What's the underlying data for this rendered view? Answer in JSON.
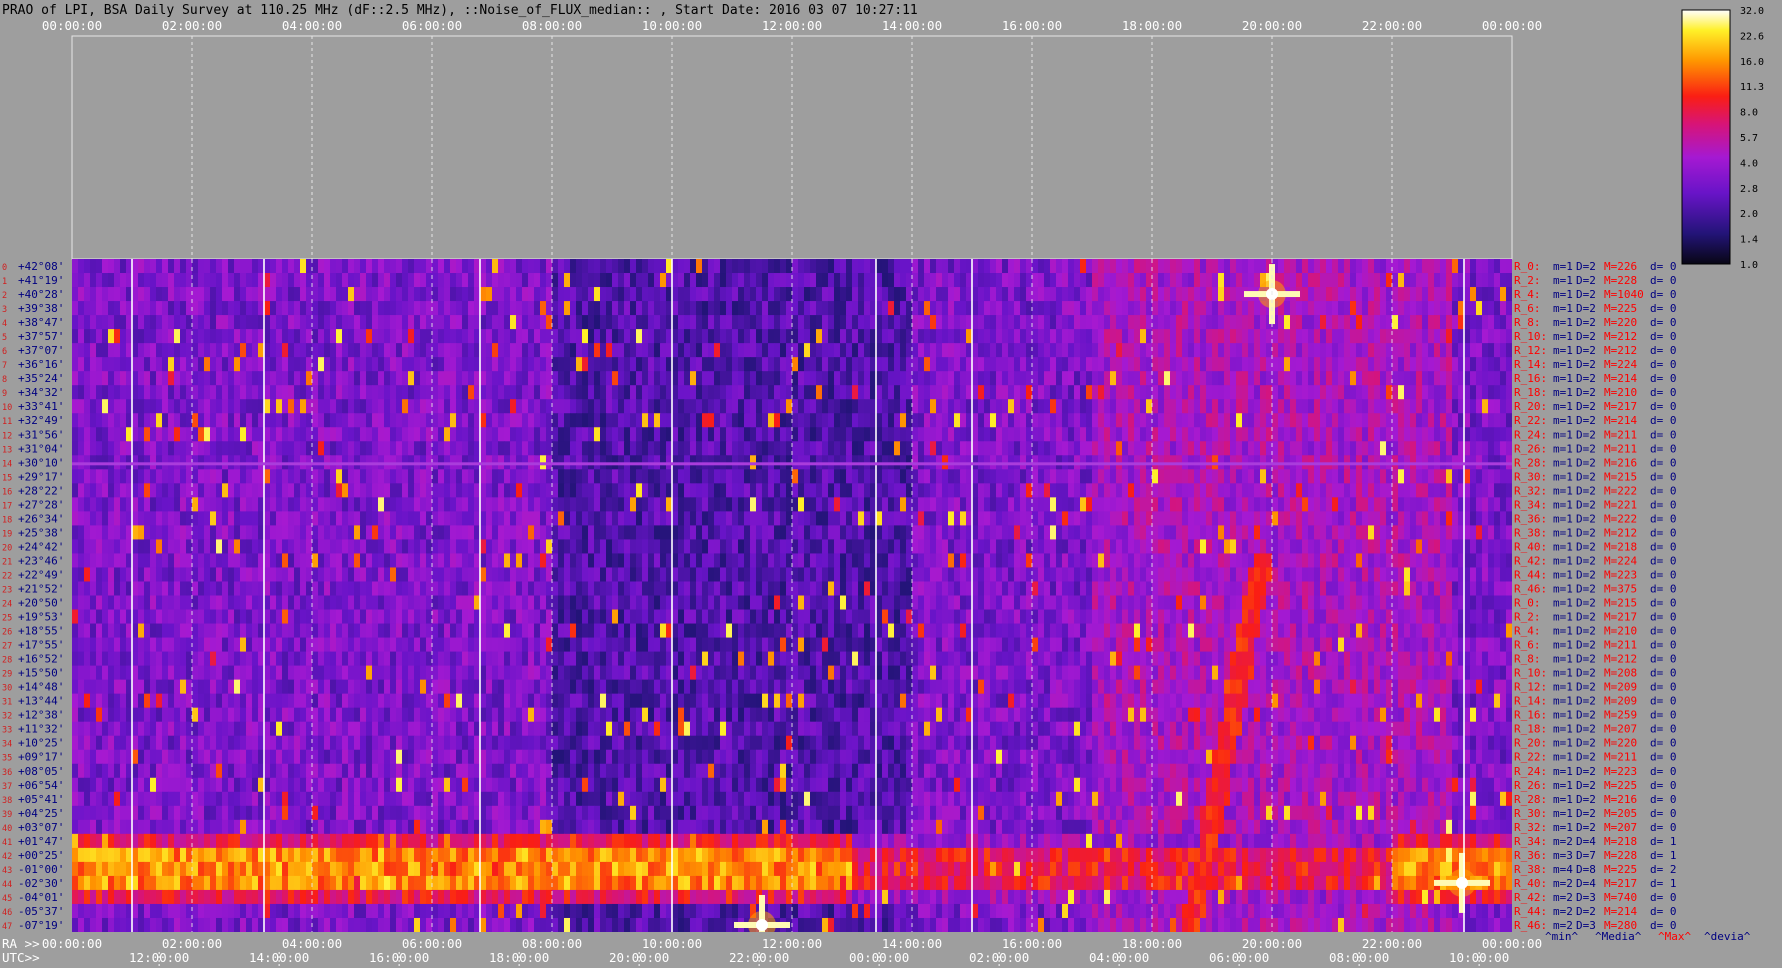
{
  "title": "PRAO of LPI, BSA Daily Survey at 110.25 MHz (dF::2.5 MHz), ::Noise_of_FLUX_median:: , Start Date: 2016 03 07 10:27:11",
  "colors": {
    "background": "#9e9e9e",
    "row_label": "#000080",
    "stat_red": "#ff0000",
    "stat_navy": "#000080"
  },
  "top_axis_labels": [
    "00:00:00",
    "02:00:00",
    "04:00:00",
    "06:00:00",
    "08:00:00",
    "10:00:00",
    "12:00:00",
    "14:00:00",
    "16:00:00",
    "18:00:00",
    "20:00:00",
    "22:00:00",
    "00:00:00"
  ],
  "ra_axis": {
    "prefix": "RA >>",
    "labels": [
      "00:00:00",
      "02:00:00",
      "04:00:00",
      "06:00:00",
      "08:00:00",
      "10:00:00",
      "12:00:00",
      "14:00:00",
      "16:00:00",
      "18:00:00",
      "20:00:00",
      "22:00:00",
      "00:00:00"
    ]
  },
  "utc_axis": {
    "prefix": "UTC>>",
    "labels": [
      "12:00:00",
      "14:00:00",
      "16:00:00",
      "18:00:00",
      "20:00:00",
      "22:00:00",
      "00:00:00",
      "02:00:00",
      "04:00:00",
      "06:00:00",
      "08:00:00",
      "10:00:00"
    ]
  },
  "colorbar": {
    "ticks": [
      "32.0",
      "22.6",
      "16.0",
      "11.3",
      "8.0",
      "5.7",
      "4.0",
      "2.8",
      "2.0",
      "1.4",
      "1.0"
    ]
  },
  "declinations": [
    "+42°08'",
    "+41°19'",
    "+40°28'",
    "+39°38'",
    "+38°47'",
    "+37°57'",
    "+37°07'",
    "+36°16'",
    "+35°24'",
    "+34°32'",
    "+33°41'",
    "+32°49'",
    "+31°56'",
    "+31°04'",
    "+30°10'",
    "+29°17'",
    "+28°22'",
    "+27°28'",
    "+26°34'",
    "+25°38'",
    "+24°42'",
    "+23°46'",
    "+22°49'",
    "+21°52'",
    "+20°50'",
    "+19°53'",
    "+18°55'",
    "+17°55'",
    "+16°52'",
    "+15°50'",
    "+14°48'",
    "+13°44'",
    "+12°38'",
    "+11°32'",
    "+10°25'",
    "+09°17'",
    "+08°05'",
    "+06°54'",
    "+05°41'",
    "+04°25'",
    "+03°07'",
    "+01°47'",
    "+00°25'",
    "-01°00'",
    "-02°30'",
    "-04°01'",
    "-05°37'",
    "-07°19'"
  ],
  "stats_rows": [
    {
      "r": "R_0:",
      "m": "m=1",
      "d": "D=2",
      "M": "M=226",
      "dv": "d= 0"
    },
    {
      "r": "R_2:",
      "m": "m=1",
      "d": "D=2",
      "M": "M=228",
      "dv": "d= 0"
    },
    {
      "r": "R_4:",
      "m": "m=1",
      "d": "D=2",
      "M": "M=1040",
      "dv": "d= 0"
    },
    {
      "r": "R_6:",
      "m": "m=1",
      "d": "D=2",
      "M": "M=225",
      "dv": "d= 0"
    },
    {
      "r": "R_8:",
      "m": "m=1",
      "d": "D=2",
      "M": "M=220",
      "dv": "d= 0"
    },
    {
      "r": "R_10:",
      "m": "m=1",
      "d": "D=2",
      "M": "M=212",
      "dv": "d= 0"
    },
    {
      "r": "R_12:",
      "m": "m=1",
      "d": "D=2",
      "M": "M=212",
      "dv": "d= 0"
    },
    {
      "r": "R_14:",
      "m": "m=1",
      "d": "D=2",
      "M": "M=224",
      "dv": "d= 0"
    },
    {
      "r": "R_16:",
      "m": "m=1",
      "d": "D=2",
      "M": "M=214",
      "dv": "d= 0"
    },
    {
      "r": "R_18:",
      "m": "m=1",
      "d": "D=2",
      "M": "M=210",
      "dv": "d= 0"
    },
    {
      "r": "R_20:",
      "m": "m=1",
      "d": "D=2",
      "M": "M=217",
      "dv": "d= 0"
    },
    {
      "r": "R_22:",
      "m": "m=1",
      "d": "D=2",
      "M": "M=214",
      "dv": "d= 0"
    },
    {
      "r": "R_24:",
      "m": "m=1",
      "d": "D=2",
      "M": "M=211",
      "dv": "d= 0"
    },
    {
      "r": "R_26:",
      "m": "m=1",
      "d": "D=2",
      "M": "M=211",
      "dv": "d= 0"
    },
    {
      "r": "R_28:",
      "m": "m=1",
      "d": "D=2",
      "M": "M=216",
      "dv": "d= 0"
    },
    {
      "r": "R_30:",
      "m": "m=1",
      "d": "D=2",
      "M": "M=215",
      "dv": "d= 0"
    },
    {
      "r": "R_32:",
      "m": "m=1",
      "d": "D=2",
      "M": "M=222",
      "dv": "d= 0"
    },
    {
      "r": "R_34:",
      "m": "m=1",
      "d": "D=2",
      "M": "M=221",
      "dv": "d= 0"
    },
    {
      "r": "R_36:",
      "m": "m=1",
      "d": "D=2",
      "M": "M=222",
      "dv": "d= 0"
    },
    {
      "r": "R_38:",
      "m": "m=1",
      "d": "D=2",
      "M": "M=212",
      "dv": "d= 0"
    },
    {
      "r": "R_40:",
      "m": "m=1",
      "d": "D=2",
      "M": "M=218",
      "dv": "d= 0"
    },
    {
      "r": "R_42:",
      "m": "m=1",
      "d": "D=2",
      "M": "M=224",
      "dv": "d= 0"
    },
    {
      "r": "R_44:",
      "m": "m=1",
      "d": "D=2",
      "M": "M=223",
      "dv": "d= 0"
    },
    {
      "r": "R_46:",
      "m": "m=1",
      "d": "D=2",
      "M": "M=375",
      "dv": "d= 0"
    },
    {
      "r": "R_0:",
      "m": "m=1",
      "d": "D=2",
      "M": "M=215",
      "dv": "d= 0"
    },
    {
      "r": "R_2:",
      "m": "m=1",
      "d": "D=2",
      "M": "M=217",
      "dv": "d= 0"
    },
    {
      "r": "R_4:",
      "m": "m=1",
      "d": "D=2",
      "M": "M=210",
      "dv": "d= 0"
    },
    {
      "r": "R_6:",
      "m": "m=1",
      "d": "D=2",
      "M": "M=211",
      "dv": "d= 0"
    },
    {
      "r": "R_8:",
      "m": "m=1",
      "d": "D=2",
      "M": "M=212",
      "dv": "d= 0"
    },
    {
      "r": "R_10:",
      "m": "m=1",
      "d": "D=2",
      "M": "M=208",
      "dv": "d= 0"
    },
    {
      "r": "R_12:",
      "m": "m=1",
      "d": "D=2",
      "M": "M=209",
      "dv": "d= 0"
    },
    {
      "r": "R_14:",
      "m": "m=1",
      "d": "D=2",
      "M": "M=209",
      "dv": "d= 0"
    },
    {
      "r": "R_16:",
      "m": "m=1",
      "d": "D=2",
      "M": "M=259",
      "dv": "d= 0"
    },
    {
      "r": "R_18:",
      "m": "m=1",
      "d": "D=2",
      "M": "M=207",
      "dv": "d= 0"
    },
    {
      "r": "R_20:",
      "m": "m=1",
      "d": "D=2",
      "M": "M=220",
      "dv": "d= 0"
    },
    {
      "r": "R_22:",
      "m": "m=1",
      "d": "D=2",
      "M": "M=211",
      "dv": "d= 0"
    },
    {
      "r": "R_24:",
      "m": "m=1",
      "d": "D=2",
      "M": "M=223",
      "dv": "d= 0"
    },
    {
      "r": "R_26:",
      "m": "m=1",
      "d": "D=2",
      "M": "M=225",
      "dv": "d= 0"
    },
    {
      "r": "R_28:",
      "m": "m=1",
      "d": "D=2",
      "M": "M=216",
      "dv": "d= 0"
    },
    {
      "r": "R_30:",
      "m": "m=1",
      "d": "D=2",
      "M": "M=205",
      "dv": "d= 0"
    },
    {
      "r": "R_32:",
      "m": "m=1",
      "d": "D=2",
      "M": "M=207",
      "dv": "d= 0"
    },
    {
      "r": "R_34:",
      "m": "m=2",
      "d": "D=4",
      "M": "M=218",
      "dv": "d= 1"
    },
    {
      "r": "R_36:",
      "m": "m=3",
      "d": "D=7",
      "M": "M=228",
      "dv": "d= 1"
    },
    {
      "r": "R_38:",
      "m": "m=4",
      "d": "D=8",
      "M": "M=225",
      "dv": "d= 2"
    },
    {
      "r": "R_40:",
      "m": "m=2",
      "d": "D=4",
      "M": "M=217",
      "dv": "d= 1"
    },
    {
      "r": "R_42:",
      "m": "m=2",
      "d": "D=3",
      "M": "M=740",
      "dv": "d= 0"
    },
    {
      "r": "R_44:",
      "m": "m=2",
      "d": "D=2",
      "M": "M=214",
      "dv": "d= 0"
    },
    {
      "r": "R_46:",
      "m": "m=2",
      "d": "D=3",
      "M": "M=280",
      "dv": "d= 0"
    }
  ],
  "legend": {
    "min": "^min^",
    "median": "^Media^",
    "max": "^Max^",
    "deviation": "^devia^"
  },
  "chart_data": {
    "type": "heatmap",
    "title": "PRAO of LPI, BSA Daily Survey at 110.25 MHz (dF::2.5 MHz), ::Noise_of_FLUX_median:: , Start Date: 2016 03 07 10:27:11",
    "x_axis": "RA 00:00:00 to 24:00:00 (2-hour ticks), UTC 10:27 start",
    "y_categories": "declinations",
    "colorbar_range": [
      1.0,
      32.0
    ],
    "colorbar_scale": "log2",
    "features": [
      {
        "kind": "horizontal bright band",
        "dec_range": [
          "+01°47'",
          "-04°01'"
        ],
        "ra_range": [
          "00:00:00",
          "24:00:00"
        ],
        "level": 16.0
      },
      {
        "kind": "diagonal bright track",
        "ra_start": "18:40:00",
        "ra_end": "19:50:00",
        "dec_start": "-07°19'",
        "dec_end": "+23°46'",
        "level": 8.0
      },
      {
        "kind": "bright source",
        "ra": "20:00:00",
        "dec": "+40°28'",
        "level": 32.0
      },
      {
        "kind": "bright source",
        "ra": "23:10:00",
        "dec": "-02°30'",
        "level": 32.0
      },
      {
        "kind": "bright source",
        "ra": "11:30:00",
        "dec": "-07°19'",
        "level": 32.0
      }
    ]
  }
}
